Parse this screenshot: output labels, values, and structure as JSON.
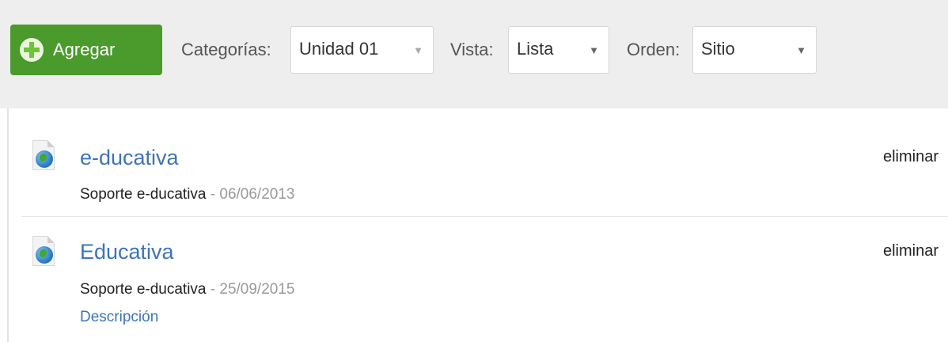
{
  "toolbar": {
    "add_label": "Agregar",
    "categorias_label": "Categorías:",
    "categorias_value": "Unidad 01",
    "vista_label": "Vista:",
    "vista_value": "Lista",
    "orden_label": "Orden:",
    "orden_value": "Sitio",
    "arrow": "▼"
  },
  "items": [
    {
      "title": "e-ducativa",
      "author": "Soporte e-ducativa",
      "sep": " - ",
      "date": "06/06/2013",
      "delete_label": "eliminar",
      "icon": "globe-document-icon"
    },
    {
      "title": "Educativa",
      "author": "Soporte e-ducativa",
      "sep": " - ",
      "date": "25/09/2015",
      "description_link": "Descripción",
      "delete_label": "eliminar",
      "icon": "globe-document-icon"
    }
  ],
  "colors": {
    "add_button": "#4b9a2c",
    "link": "#3d74b8",
    "toolbar_bg": "#eeeeee"
  }
}
